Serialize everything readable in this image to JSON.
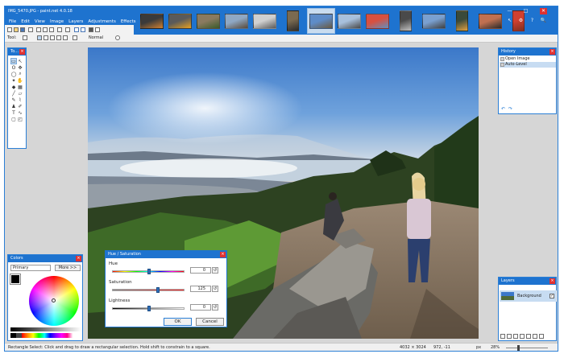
{
  "window": {
    "title": "IMG_5470.JPG - paint.net 4.0.18"
  },
  "menu": [
    "File",
    "Edit",
    "View",
    "Image",
    "Layers",
    "Adjustments",
    "Effects"
  ],
  "menu_more": "›",
  "window_controls": {
    "minimize": "—",
    "maximize": "□",
    "close": "✕",
    "icons": [
      "↖",
      "⚙",
      "?",
      "🔍"
    ]
  },
  "toolbar2": {
    "tool_label": "Tool:",
    "mode_label": "Normal"
  },
  "thumbnails": [
    {
      "name": "thumb-1",
      "colors": [
        "#3a3a3a",
        "#d08030"
      ]
    },
    {
      "name": "thumb-2",
      "colors": [
        "#5a5a5a",
        "#e6a020"
      ]
    },
    {
      "name": "thumb-3",
      "colors": [
        "#8a7a60",
        "#3a5a2a"
      ]
    },
    {
      "name": "thumb-4",
      "colors": [
        "#8fa8c4",
        "#5a4a3a"
      ]
    },
    {
      "name": "thumb-5",
      "colors": [
        "#d0d0d0",
        "#5a5a5a"
      ]
    },
    {
      "name": "thumb-6",
      "colors": [
        "#7a6a50",
        "#2a2a2a"
      ]
    },
    {
      "name": "thumb-7",
      "colors": [
        "#5e8cc8",
        "#6a5a40"
      ]
    },
    {
      "name": "thumb-8",
      "colors": [
        "#a8c0dc",
        "#4a4a4a"
      ]
    },
    {
      "name": "thumb-9",
      "colors": [
        "#d85040",
        "#6090c0"
      ]
    },
    {
      "name": "thumb-10",
      "colors": [
        "#4a4a4a",
        "#c0c0c0"
      ]
    },
    {
      "name": "thumb-11",
      "colors": [
        "#7aa0d0",
        "#404040"
      ]
    },
    {
      "name": "thumb-12",
      "colors": [
        "#3a4a3a",
        "#e0a040"
      ]
    },
    {
      "name": "thumb-13",
      "colors": [
        "#c07050",
        "#2a2a2a"
      ]
    },
    {
      "name": "thumb-14",
      "colors": [
        "#d04030",
        "#803020"
      ]
    }
  ],
  "tools_panel": {
    "title": "To..."
  },
  "history_panel": {
    "title": "History",
    "items": [
      "Open Image",
      "Auto-Level"
    ]
  },
  "colors_panel": {
    "title": "Colors",
    "primary": "Primary",
    "more": "More >>"
  },
  "layers_panel": {
    "title": "Layers",
    "layer": "Background"
  },
  "hue_dialog": {
    "title": "Hue / Saturation",
    "hue_label": "Hue",
    "hue_value": "0",
    "saturation_label": "Saturation",
    "saturation_value": "125",
    "lightness_label": "Lightness",
    "lightness_value": "0",
    "ok": "OK",
    "cancel": "Cancel"
  },
  "status": {
    "text": "Rectangle Select: Click and drag to draw a rectangular selection. Hold shift to constrain to a square.",
    "size": "4032 × 3024",
    "cursor": "972, -11",
    "unit": "px",
    "zoom": "28%"
  }
}
